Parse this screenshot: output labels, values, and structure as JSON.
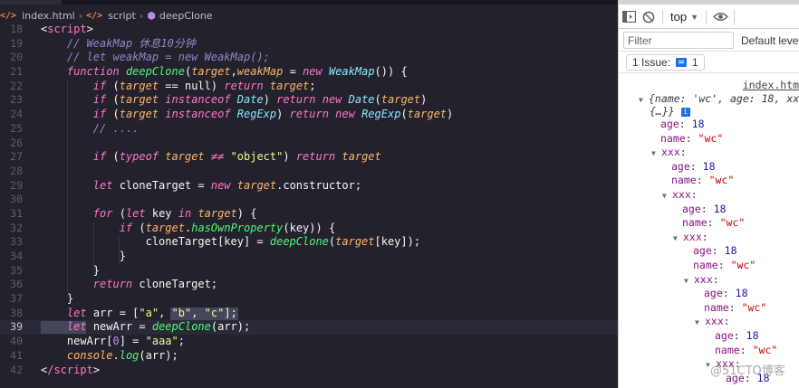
{
  "breadcrumb": {
    "file": "index.html",
    "section": "script",
    "symbol": "deepClone"
  },
  "devtools": {
    "context": "top",
    "filter_placeholder": "Filter",
    "levels": "Default levels",
    "issues": "1 Issue:",
    "issues_count": "1",
    "source_link": "index.html",
    "tree": {
      "summary_line1": "{name: 'wc', age: 18, xxx:",
      "summary_line2": "{…}}",
      "info": "i",
      "levels": [
        {
          "age_key": "age",
          "age_val": "18",
          "name_key": "name",
          "name_val": "\"wc\"",
          "child": "xxx"
        },
        {
          "age_key": "age",
          "age_val": "18",
          "name_key": "name",
          "name_val": "\"wc\"",
          "child": "xxx"
        },
        {
          "age_key": "age",
          "age_val": "18",
          "name_key": "name",
          "name_val": "\"wc\"",
          "child": "xxx"
        },
        {
          "age_key": "age",
          "age_val": "18",
          "name_key": "name",
          "name_val": "\"wc\"",
          "child": "xxx"
        },
        {
          "age_key": "age",
          "age_val": "18",
          "name_key": "name",
          "name_val": "\"wc\"",
          "child": "xxx"
        },
        {
          "age_key": "age",
          "age_val": "18",
          "name_key": "name",
          "name_val": "\"wc\"",
          "child": "xxx"
        },
        {
          "age_key": "age",
          "age_val": "18"
        }
      ]
    }
  },
  "editor": {
    "active_line": 39,
    "lines": [
      {
        "n": 18,
        "t": [
          [
            "t-plain",
            "<"
          ],
          [
            "t-tag",
            "script"
          ],
          [
            "t-plain",
            ">"
          ]
        ]
      },
      {
        "n": 19,
        "t": [
          [
            "t-plain",
            "    "
          ],
          [
            "t-cmt",
            "// WeakMap 休息10分钟"
          ]
        ]
      },
      {
        "n": 20,
        "t": [
          [
            "t-plain",
            "    "
          ],
          [
            "t-cmt",
            "// let weakMap = new WeakMap();"
          ]
        ]
      },
      {
        "n": 21,
        "t": [
          [
            "t-plain",
            "    "
          ],
          [
            "t-kw",
            "function "
          ],
          [
            "t-fn",
            "deepClone"
          ],
          [
            "t-plain",
            "("
          ],
          [
            "t-var",
            "target"
          ],
          [
            "t-plain",
            ","
          ],
          [
            "t-var",
            "weakMap"
          ],
          [
            "t-plain",
            " = "
          ],
          [
            "t-kw",
            "new "
          ],
          [
            "t-cls",
            "WeakMap"
          ],
          [
            "t-plain",
            "()) {"
          ]
        ]
      },
      {
        "n": 22,
        "t": [
          [
            "t-plain",
            "        "
          ],
          [
            "t-kw",
            "if "
          ],
          [
            "t-plain",
            "("
          ],
          [
            "t-var",
            "target"
          ],
          [
            "t-plain",
            " == "
          ],
          [
            "t-plain",
            "null) "
          ],
          [
            "t-kw",
            "return "
          ],
          [
            "t-var",
            "target"
          ],
          [
            "t-plain",
            ";"
          ]
        ]
      },
      {
        "n": 23,
        "t": [
          [
            "t-plain",
            "        "
          ],
          [
            "t-kw",
            "if "
          ],
          [
            "t-plain",
            "("
          ],
          [
            "t-var",
            "target "
          ],
          [
            "t-kw",
            "instanceof "
          ],
          [
            "t-cls",
            "Date"
          ],
          [
            "t-plain",
            ") "
          ],
          [
            "t-kw",
            "return new "
          ],
          [
            "t-cls",
            "Date"
          ],
          [
            "t-plain",
            "("
          ],
          [
            "t-var",
            "target"
          ],
          [
            "t-plain",
            ")"
          ]
        ]
      },
      {
        "n": 24,
        "t": [
          [
            "t-plain",
            "        "
          ],
          [
            "t-kw",
            "if "
          ],
          [
            "t-plain",
            "("
          ],
          [
            "t-var",
            "target "
          ],
          [
            "t-kw",
            "instanceof "
          ],
          [
            "t-cls",
            "RegExp"
          ],
          [
            "t-plain",
            ") "
          ],
          [
            "t-kw",
            "return new "
          ],
          [
            "t-cls",
            "RegExp"
          ],
          [
            "t-plain",
            "("
          ],
          [
            "t-var",
            "target"
          ],
          [
            "t-plain",
            ")"
          ]
        ]
      },
      {
        "n": 25,
        "t": [
          [
            "t-plain",
            "        "
          ],
          [
            "t-cmt",
            "// ...."
          ]
        ]
      },
      {
        "n": 26,
        "t": []
      },
      {
        "n": 27,
        "t": [
          [
            "t-plain",
            "        "
          ],
          [
            "t-kw",
            "if "
          ],
          [
            "t-plain",
            "("
          ],
          [
            "t-kw",
            "typeof "
          ],
          [
            "t-var",
            "target "
          ],
          [
            "t-op",
            "≠≠ "
          ],
          [
            "t-str",
            "\"object\""
          ],
          [
            "t-plain",
            ") "
          ],
          [
            "t-kw",
            "return "
          ],
          [
            "t-var",
            "target"
          ]
        ]
      },
      {
        "n": 28,
        "t": []
      },
      {
        "n": 29,
        "t": [
          [
            "t-plain",
            "        "
          ],
          [
            "t-kw",
            "let "
          ],
          [
            "t-plain",
            "cloneTarget = "
          ],
          [
            "t-kw",
            "new "
          ],
          [
            "t-var",
            "target"
          ],
          [
            "t-plain",
            ".constructor;"
          ]
        ]
      },
      {
        "n": 30,
        "t": []
      },
      {
        "n": 31,
        "t": [
          [
            "t-plain",
            "        "
          ],
          [
            "t-kw",
            "for "
          ],
          [
            "t-plain",
            "("
          ],
          [
            "t-kw",
            "let "
          ],
          [
            "t-plain",
            "key "
          ],
          [
            "t-kw",
            "in "
          ],
          [
            "t-var",
            "target"
          ],
          [
            "t-plain",
            ") {"
          ]
        ]
      },
      {
        "n": 32,
        "t": [
          [
            "t-plain",
            "            "
          ],
          [
            "t-kw",
            "if "
          ],
          [
            "t-plain",
            "("
          ],
          [
            "t-var",
            "target"
          ],
          [
            "t-plain",
            "."
          ],
          [
            "t-fn",
            "hasOwnProperty"
          ],
          [
            "t-plain",
            "(key)) {"
          ]
        ]
      },
      {
        "n": 33,
        "t": [
          [
            "t-plain",
            "                cloneTarget[key] = "
          ],
          [
            "t-fn",
            "deepClone"
          ],
          [
            "t-plain",
            "("
          ],
          [
            "t-var",
            "target"
          ],
          [
            "t-plain",
            "[key]);"
          ]
        ]
      },
      {
        "n": 34,
        "t": [
          [
            "t-plain",
            "            }"
          ]
        ]
      },
      {
        "n": 35,
        "t": [
          [
            "t-plain",
            "        }"
          ]
        ]
      },
      {
        "n": 36,
        "t": [
          [
            "t-plain",
            "        "
          ],
          [
            "t-kw",
            "return "
          ],
          [
            "t-plain",
            "cloneTarget;"
          ]
        ]
      },
      {
        "n": 37,
        "t": [
          [
            "t-plain",
            "    }"
          ]
        ]
      },
      {
        "n": 38,
        "t": [
          [
            "t-plain",
            "    "
          ],
          [
            "t-kw",
            "let "
          ],
          [
            "t-plain",
            "arr = ["
          ],
          [
            "t-str",
            "\"a\""
          ],
          [
            "t-plain",
            ", "
          ],
          [
            "t-str",
            "\"b\""
          ],
          [
            "t-plain",
            ", "
          ],
          [
            "t-str",
            "\"c\""
          ],
          [
            "t-plain",
            "];"
          ]
        ]
      },
      {
        "n": 39,
        "t": [
          [
            "t-plain",
            "    "
          ],
          [
            "t-kw",
            "let "
          ],
          [
            "t-plain",
            "newArr = "
          ],
          [
            "t-fn",
            "deepClone"
          ],
          [
            "t-plain",
            "(arr);"
          ]
        ]
      },
      {
        "n": 40,
        "t": [
          [
            "t-plain",
            "    newArr["
          ],
          [
            "t-null",
            "0"
          ],
          [
            "t-plain",
            "] = "
          ],
          [
            "t-str",
            "\"aaa\""
          ],
          [
            "t-plain",
            ";"
          ]
        ]
      },
      {
        "n": 41,
        "t": [
          [
            "t-plain",
            "    "
          ],
          [
            "t-var",
            "console"
          ],
          [
            "t-plain",
            "."
          ],
          [
            "t-fn",
            "log"
          ],
          [
            "t-plain",
            "(arr);"
          ]
        ]
      },
      {
        "n": 42,
        "t": [
          [
            "t-plain",
            "<"
          ],
          [
            "t-tag",
            "/script"
          ],
          [
            "t-plain",
            ">"
          ]
        ]
      }
    ]
  },
  "watermark": "@51CTO博客"
}
